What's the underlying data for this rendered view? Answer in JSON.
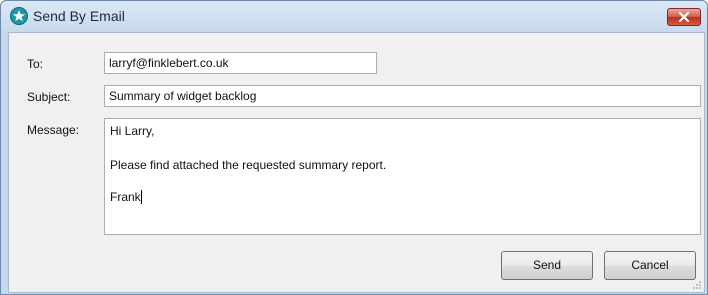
{
  "window": {
    "title": "Send By Email",
    "icon": "app-star-icon",
    "close_icon": "close-icon"
  },
  "form": {
    "to_label": "To:",
    "to_value": "larryf@finklebert.co.uk",
    "subject_label": "Subject:",
    "subject_value": "Summary of widget backlog",
    "message_label": "Message:",
    "message_lines": [
      "Hi Larry,",
      "Please find attached the requested summary report.",
      "Frank"
    ]
  },
  "buttons": {
    "send_label": "Send",
    "cancel_label": "Cancel"
  },
  "colors": {
    "title_bar": "#c8daee",
    "close_button": "#c9432c",
    "dialog_background": "#f0f0f0"
  }
}
